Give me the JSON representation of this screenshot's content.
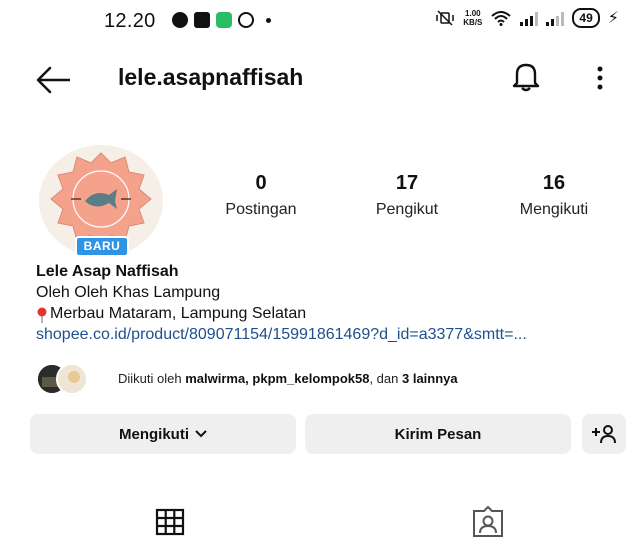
{
  "status_bar": {
    "time": "12.20",
    "net_speed_value": "1.00",
    "net_speed_unit": "KB/S",
    "battery": "49"
  },
  "header": {
    "username": "lele.asapnaffisah",
    "icons": [
      "back-arrow-icon",
      "bell-icon",
      "more-vertical-icon"
    ]
  },
  "profile": {
    "badge": "BARU",
    "stats": [
      {
        "value": "0",
        "label": "Postingan"
      },
      {
        "value": "17",
        "label": "Pengikut"
      },
      {
        "value": "16",
        "label": "Mengikuti"
      }
    ],
    "display_name": "Lele Asap Naffisah",
    "bio_line": "Oleh Oleh Khas Lampung",
    "location": "Merbau Mataram, Lampung Selatan",
    "link": "shopee.co.id/product/809071154/15991861469?d_id=a3377&smtt=..."
  },
  "followed_by": {
    "prefix": "Diikuti oleh ",
    "users": "malwirma, pkpm_kelompok58",
    "middle": ", dan ",
    "others": "3 lainnya"
  },
  "buttons": {
    "following": "Mengikuti",
    "message": "Kirim Pesan",
    "add_user_icon": "+person-icon"
  },
  "tabs": [
    "grid-icon",
    "tagged-icon"
  ],
  "colors": {
    "badge": "#2f93e6",
    "link": "#1f4f8f",
    "button_bg": "#efefef",
    "logo_salmon": "#f4a28c"
  }
}
